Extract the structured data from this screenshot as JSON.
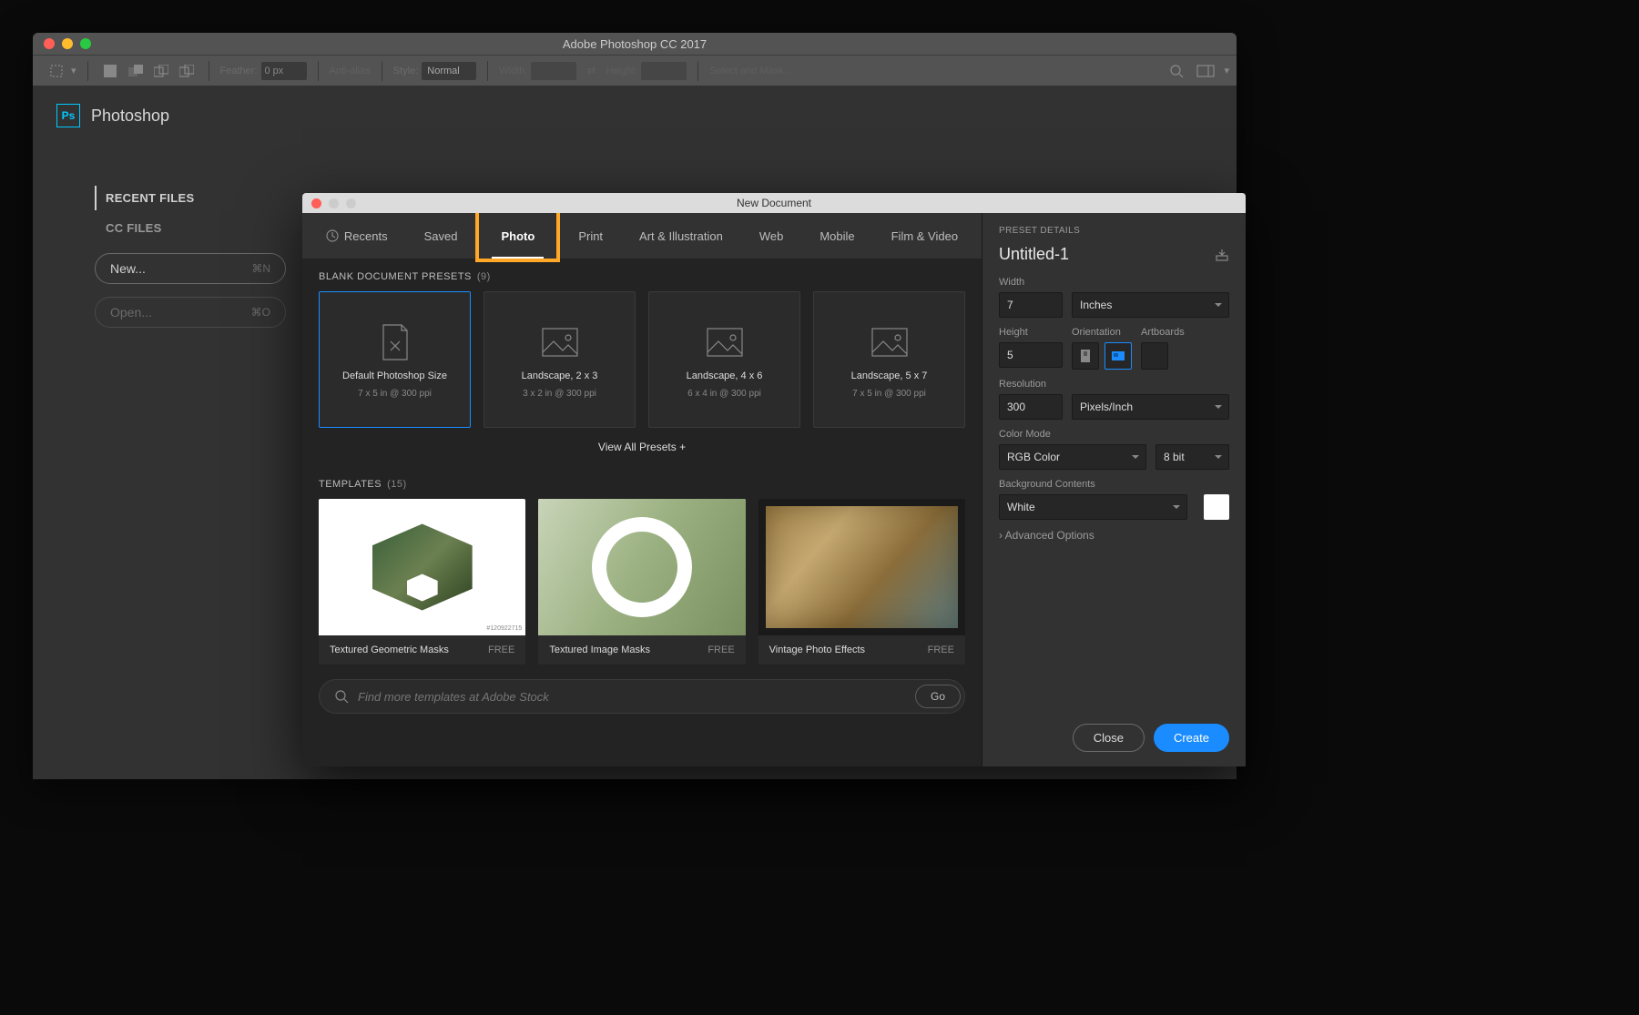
{
  "app": {
    "title": "Adobe Photoshop CC 2017",
    "logo_text": "Ps",
    "app_name": "Photoshop"
  },
  "toolbar": {
    "feather_label": "Feather:",
    "feather_value": "0 px",
    "antialias_label": "Anti-alias",
    "style_label": "Style:",
    "style_value": "Normal",
    "width_label": "Width:",
    "height_label": "Height:",
    "mask_label": "Select and Mask..."
  },
  "sidebar": {
    "recent": "RECENT FILES",
    "ccfiles": "CC FILES",
    "new_label": "New...",
    "new_shortcut": "⌘N",
    "open_label": "Open...",
    "open_shortcut": "⌘O"
  },
  "modal": {
    "title": "New Document",
    "tabs": [
      "Recents",
      "Saved",
      "Photo",
      "Print",
      "Art & Illustration",
      "Web",
      "Mobile",
      "Film & Video"
    ],
    "presets_label": "BLANK DOCUMENT PRESETS",
    "presets_count": "(9)",
    "presets": [
      {
        "title": "Default Photoshop Size",
        "sub": "7 x 5 in @ 300 ppi"
      },
      {
        "title": "Landscape, 2 x 3",
        "sub": "3 x 2 in @ 300 ppi"
      },
      {
        "title": "Landscape, 4 x 6",
        "sub": "6 x 4 in @ 300 ppi"
      },
      {
        "title": "Landscape, 5 x 7",
        "sub": "7 x 5 in @ 300 ppi"
      }
    ],
    "view_all": "View All Presets",
    "templates_label": "TEMPLATES",
    "templates_count": "(15)",
    "templates": [
      {
        "name": "Textured Geometric Masks",
        "price": "FREE",
        "id": "#120922715"
      },
      {
        "name": "Textured Image Masks",
        "price": "FREE"
      },
      {
        "name": "Vintage Photo Effects",
        "price": "FREE"
      }
    ],
    "search_placeholder": "Find more templates at Adobe Stock",
    "go": "Go"
  },
  "detail": {
    "label": "PRESET DETAILS",
    "name": "Untitled-1",
    "width_label": "Width",
    "width": "7",
    "width_unit": "Inches",
    "height_label": "Height",
    "height": "5",
    "orientation_label": "Orientation",
    "artboards_label": "Artboards",
    "resolution_label": "Resolution",
    "resolution": "300",
    "resolution_unit": "Pixels/Inch",
    "colormode_label": "Color Mode",
    "colormode": "RGB Color",
    "bits": "8 bit",
    "bgcontents_label": "Background Contents",
    "bgcontents": "White",
    "advanced": "Advanced Options",
    "close": "Close",
    "create": "Create"
  }
}
